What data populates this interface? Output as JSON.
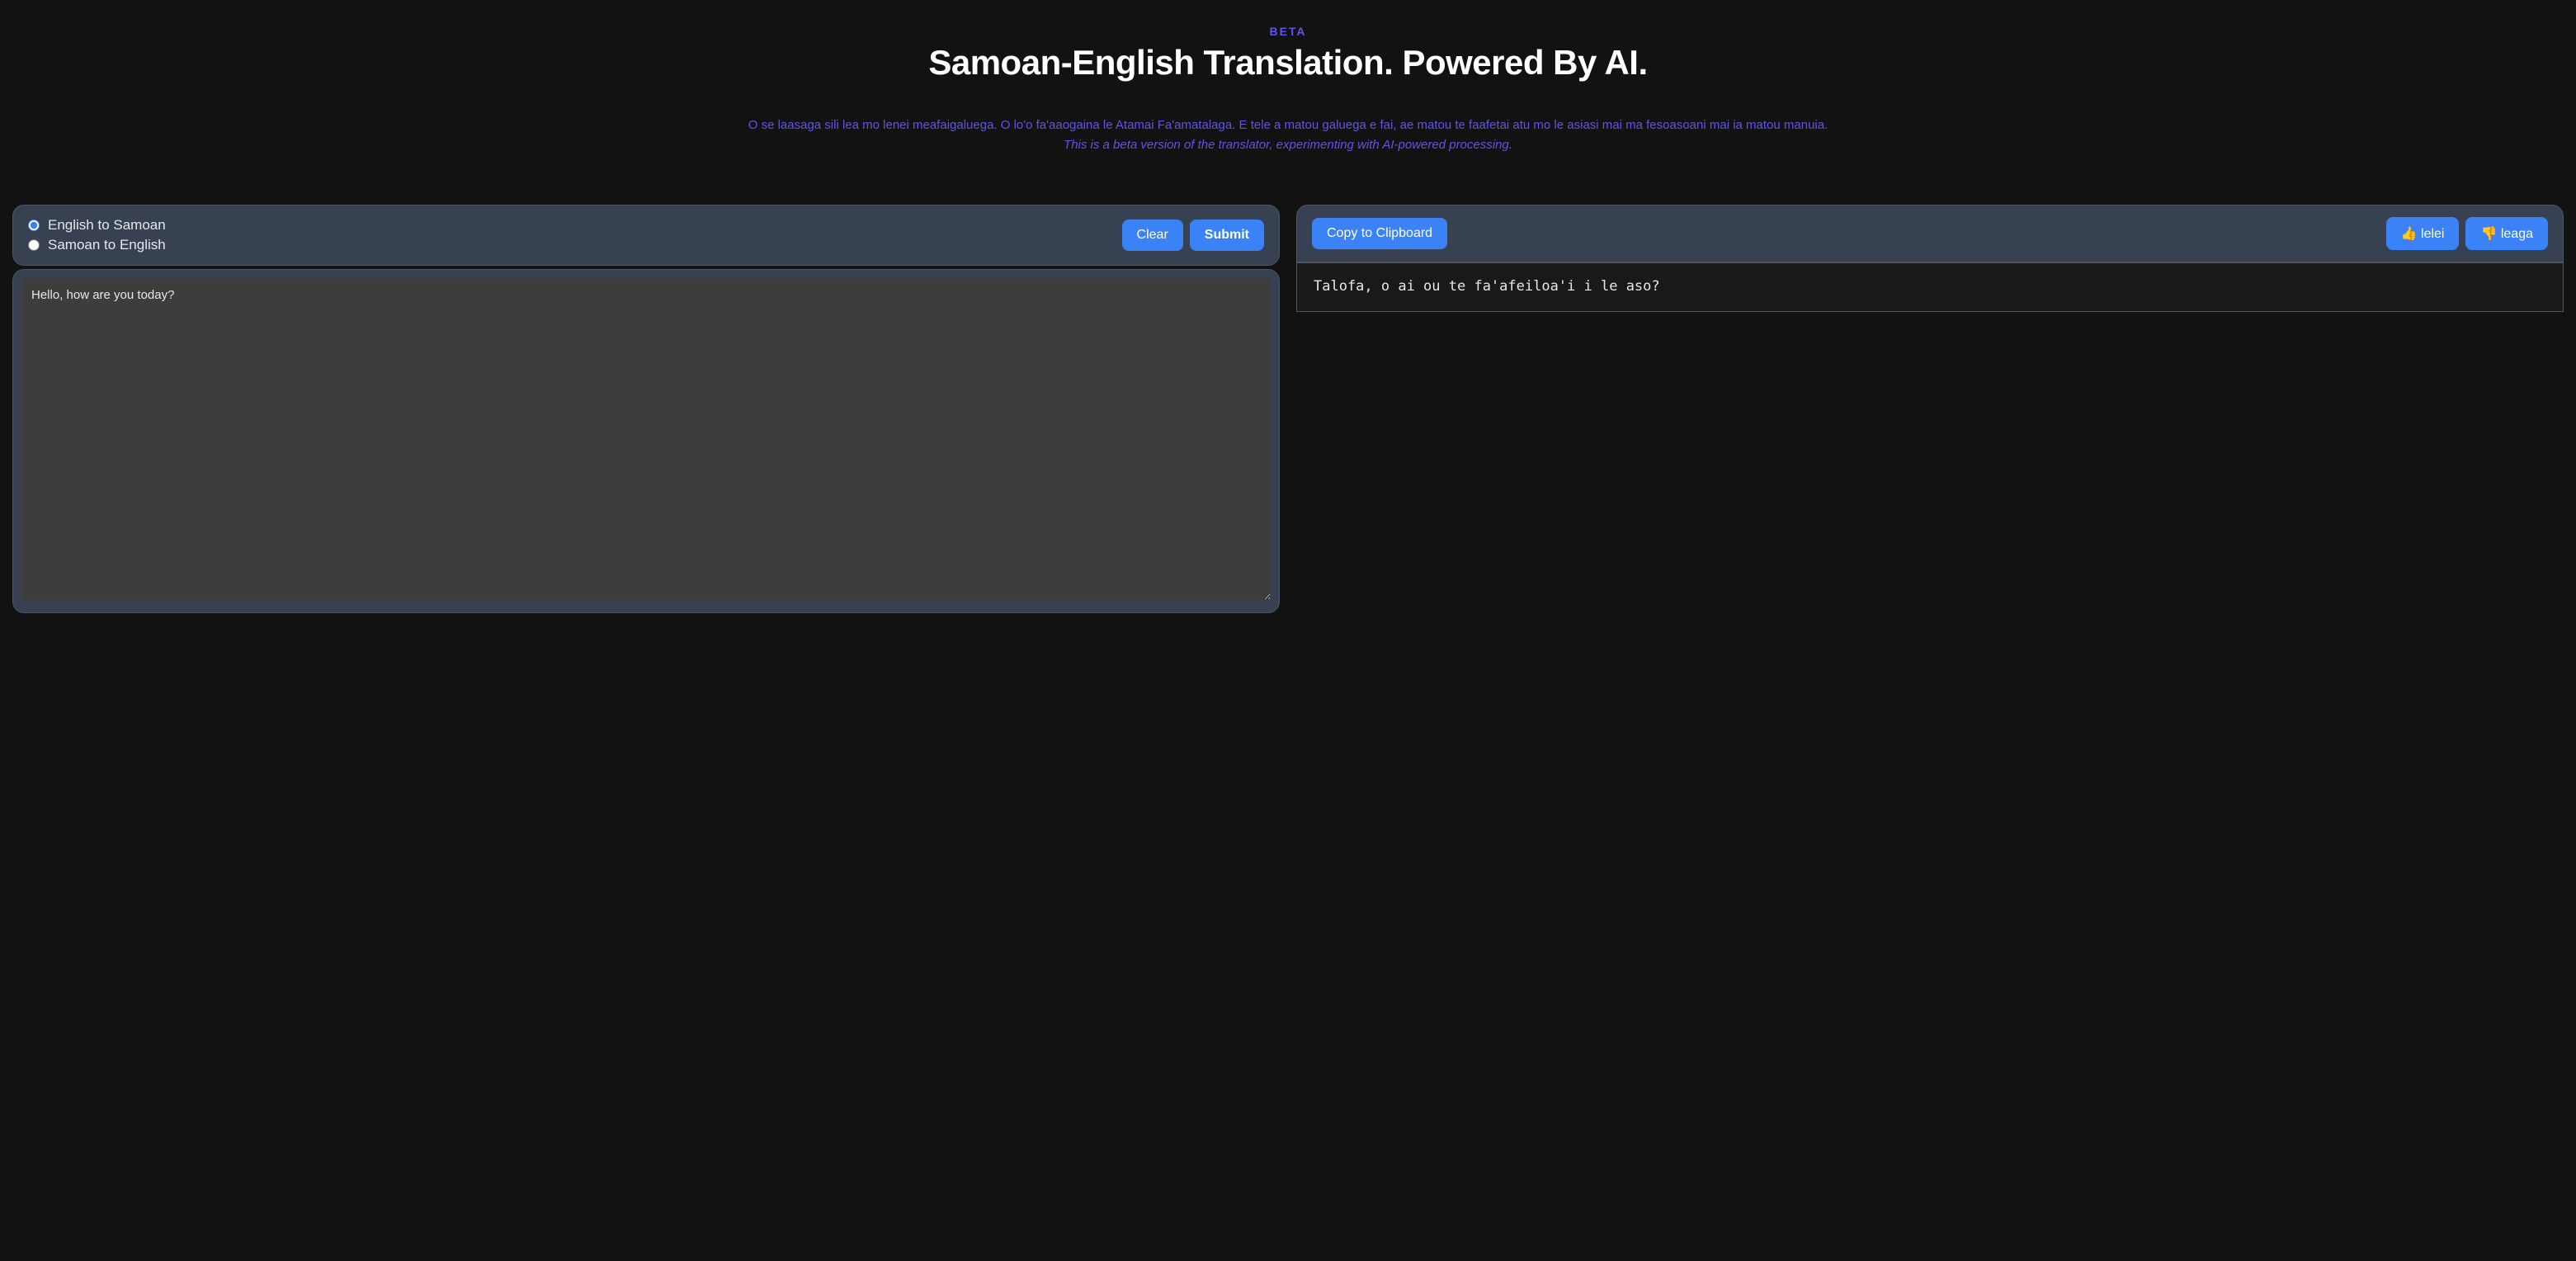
{
  "header": {
    "badge": "BETA",
    "title": "Samoan-English Translation. Powered By AI.",
    "subtitle_samoan": "O se laasaga sili lea mo lenei meafaigaluega. O lo'o fa'aaogaina le Atamai Fa'amatalaga. E tele a matou galuega e fai, ae matou te faafetai atu mo le asiasi mai ma fesoasoani mai ia matou manuia.",
    "subtitle_english": "This is a beta version of the translator, experimenting with AI-powered processing."
  },
  "input_panel": {
    "radio_en_sm": "English to Samoan",
    "radio_sm_en": "Samoan to English",
    "selected": "en_sm",
    "clear_label": "Clear",
    "submit_label": "Submit",
    "text_value": "Hello, how are you today?"
  },
  "output_panel": {
    "copy_label": "Copy to Clipboard",
    "good_label": "👍 lelei",
    "bad_label": "👎 leaga",
    "translation": "Talofa, o ai ou te fa'afeiloa'i i le aso?"
  }
}
